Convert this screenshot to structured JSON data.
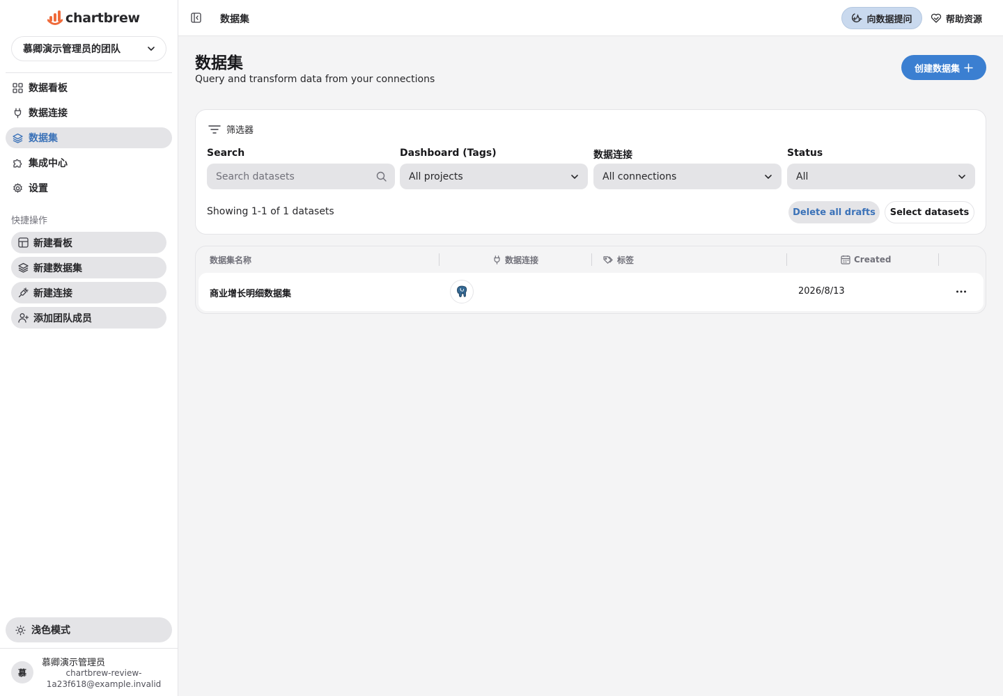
{
  "app": {
    "logo_text_a": "chart",
    "logo_text_b": "brew",
    "brand_color": "#ef6a3a"
  },
  "sidebar": {
    "team": "慕卿演示管理员的团队",
    "items": [
      {
        "label": "数据看板",
        "icon": "grid-icon"
      },
      {
        "label": "数据连接",
        "icon": "plug-icon"
      },
      {
        "label": "数据集",
        "icon": "layers-icon",
        "active": true
      },
      {
        "label": "集成中心",
        "icon": "puzzle-icon"
      },
      {
        "label": "设置",
        "icon": "gear-icon"
      }
    ],
    "quick_label": "快捷操作",
    "quick_items": [
      {
        "label": "新建看板",
        "icon": "grid-plus-icon"
      },
      {
        "label": "新建数据集",
        "icon": "layers-icon"
      },
      {
        "label": "新建连接",
        "icon": "plug-plus-icon"
      },
      {
        "label": "添加团队成员",
        "icon": "user-plus-icon"
      }
    ],
    "theme_label": "浅色模式",
    "user": {
      "initial": "慕",
      "name": "慕卿演示管理员",
      "email": "chartbrew-review-1a23f618@example.invalid"
    }
  },
  "topbar": {
    "breadcrumb": "数据集",
    "ask_label": "向数据提问",
    "help_label": "帮助资源"
  },
  "main": {
    "title": "数据集",
    "subtitle": "Query and transform data from your connections",
    "create_label": "创建数据集",
    "filters": {
      "heading": "筛选器",
      "search_label": "Search",
      "search_placeholder": "Search datasets",
      "tags_label": "Dashboard (Tags)",
      "tags_value": "All projects",
      "conn_label": "数据连接",
      "conn_value": "All connections",
      "status_label": "Status",
      "status_value": "All",
      "showing": "Showing 1-1 of 1 datasets",
      "delete_drafts": "Delete all drafts",
      "select_datasets": "Select datasets"
    },
    "table": {
      "headers": {
        "name": "数据集名称",
        "connection": "数据连接",
        "tags": "标签",
        "created": "Created"
      },
      "rows": [
        {
          "name": "商业增长明细数据集",
          "connection_icon": "postgres-icon",
          "created": "2026/8/13"
        }
      ]
    }
  },
  "colors": {
    "accent": "#3b7fd1",
    "active_text": "#3b72b8"
  }
}
